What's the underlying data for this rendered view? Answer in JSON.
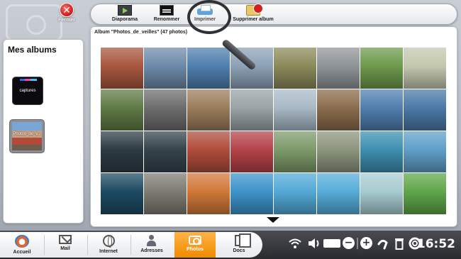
{
  "close_button": {
    "label": "Fermer",
    "icon": "close-icon",
    "color": "#d01818"
  },
  "toolbar": {
    "items": [
      {
        "label": "Diaporama",
        "icon": "slideshow-icon"
      },
      {
        "label": "Renommer",
        "icon": "rename-icon"
      },
      {
        "label": "Imprimer",
        "icon": "printer-icon"
      },
      {
        "label": "Supprimer album",
        "icon": "delete-album-icon"
      }
    ]
  },
  "sidebar": {
    "title": "Mes albums",
    "albums": [
      {
        "label": "captures"
      },
      {
        "label": "Photos_de_v..."
      }
    ]
  },
  "main": {
    "album_title": "Album \"Photos_de_veilles\" (47 photos)",
    "thumbnails": [
      {
        "subject": "red-roof harbor town",
        "color": "#a8573e"
      },
      {
        "subject": "fjord with clouds",
        "color": "#6d8aa8"
      },
      {
        "subject": "blue fjord mountains",
        "color": "#4f7fae"
      },
      {
        "subject": "misty lake",
        "color": "#8da2b6"
      },
      {
        "subject": "coastal cliff",
        "color": "#8b8a5a"
      },
      {
        "subject": "grey sea boats",
        "color": "#8f9498"
      },
      {
        "subject": "red cabin meadow",
        "color": "#6d9a4c"
      },
      {
        "subject": "grassy coast",
        "color": "#c3c7ad"
      },
      {
        "subject": "rocky moss shore",
        "color": "#607a46"
      },
      {
        "subject": "seagull on rock",
        "color": "#6c6d6c"
      },
      {
        "subject": "stone tower",
        "color": "#9a7d5c"
      },
      {
        "subject": "grey beach",
        "color": "#9aa3a6"
      },
      {
        "subject": "snowy shore",
        "color": "#a9b9c6"
      },
      {
        "subject": "brown rocks",
        "color": "#8a6c4c"
      },
      {
        "subject": "mirror fjord",
        "color": "#4f7eae"
      },
      {
        "subject": "blue mountain lake",
        "color": "#4b79a7"
      },
      {
        "subject": "dark waves",
        "color": "#2d3b44"
      },
      {
        "subject": "dark waves 2",
        "color": "#34434c"
      },
      {
        "subject": "colorful wooden houses",
        "color": "#b04c3c"
      },
      {
        "subject": "red harbour warehouses",
        "color": "#b4424a"
      },
      {
        "subject": "green hills river",
        "color": "#7d9a6a"
      },
      {
        "subject": "winding road coast",
        "color": "#8c957d"
      },
      {
        "subject": "turquoise bay",
        "color": "#3d8fb0"
      },
      {
        "subject": "white sand beach",
        "color": "#5f9fc9"
      },
      {
        "subject": "palm silhouettes",
        "color": "#1c4a62"
      },
      {
        "subject": "stone cliff wall",
        "color": "#7c7c72"
      },
      {
        "subject": "palm sunset",
        "color": "#d07838"
      },
      {
        "subject": "sign on beach",
        "color": "#3d93c9"
      },
      {
        "subject": "wooden pier huts",
        "color": "#52a9d6"
      },
      {
        "subject": "wooden pier huts 2",
        "color": "#56acd9"
      },
      {
        "subject": "heron in shallow water",
        "color": "#a8cbd0"
      },
      {
        "subject": "green leaves",
        "color": "#5fa64a"
      }
    ]
  },
  "taskbar": {
    "items": [
      {
        "label": "Accueil",
        "icon": "home-icon"
      },
      {
        "label": "Mail",
        "icon": "mail-icon"
      },
      {
        "label": "Internet",
        "icon": "globe-icon"
      },
      {
        "label": "Adresses",
        "icon": "contacts-icon"
      },
      {
        "label": "Photos",
        "icon": "camera-icon",
        "active": true
      },
      {
        "label": "Docs",
        "icon": "docs-icon"
      }
    ],
    "clock": "16:52",
    "accent": "#f08a00"
  }
}
